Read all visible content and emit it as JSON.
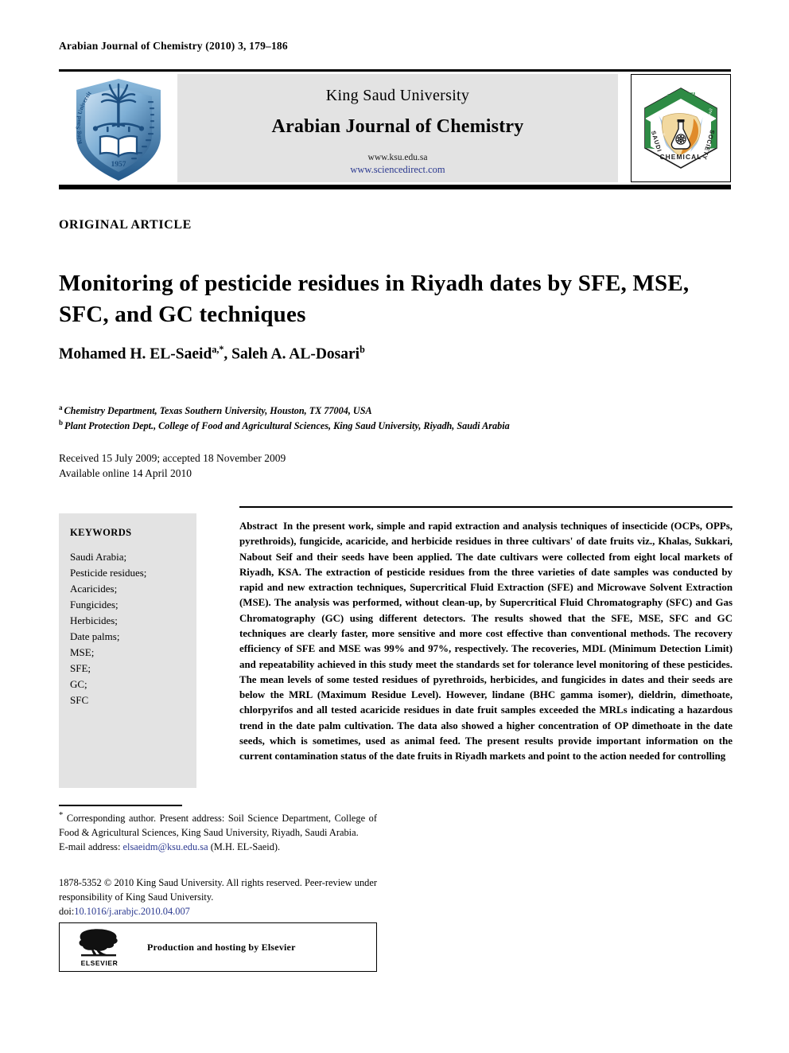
{
  "running_head": "Arabian Journal of Chemistry (2010) 3, 179–186",
  "masthead": {
    "organization": "King Saud University",
    "journal_name": "Arabian Journal of Chemistry",
    "url_org": "www.ksu.edu.sa",
    "url_publisher": "www.sciencedirect.com",
    "left_logo": "king-saud-university-shield-logo",
    "right_logo": "saudi-chemical-society-hexagon-logo",
    "left_logo_text": {
      "outer_left": "King Saud University",
      "year": "1957"
    },
    "right_logo_text": {
      "top_arabic": "الكيميائية",
      "left_arabic": "السعودية",
      "right_arabic": "الجمعية",
      "bottom": "CHEMICAL",
      "left": "SAUDI",
      "right": "SOCIETY"
    },
    "colors": {
      "band": "#e3e3e3",
      "link": "#2b3990",
      "shield_blue": "#2e6da8",
      "society_green": "#2e8b45",
      "society_orange": "#e08b2a",
      "society_map": "#f2d9a0"
    }
  },
  "article_type": "ORIGINAL ARTICLE",
  "title": "Monitoring of pesticide residues in Riyadh dates by SFE, MSE, SFC, and GC techniques",
  "authors": [
    {
      "name": "Mohamed H. EL-Saeid",
      "marks": "a,*"
    },
    {
      "name": "Saleh A. AL-Dosari",
      "marks": "b"
    }
  ],
  "affiliations": [
    {
      "mark": "a",
      "text": "Chemistry Department, Texas Southern University, Houston, TX 77004, USA"
    },
    {
      "mark": "b",
      "text": "Plant Protection Dept., College of Food and Agricultural Sciences, King Saud University, Riyadh, Saudi Arabia"
    }
  ],
  "history": {
    "received": "Received 15 July 2009; accepted 18 November 2009",
    "available": "Available online 14 April 2010"
  },
  "keywords": {
    "title": "KEYWORDS",
    "items": [
      "Saudi Arabia;",
      "Pesticide residues;",
      "Acaricides;",
      "Fungicides;",
      "Herbicides;",
      "Date palms;",
      "MSE;",
      "SFE;",
      "GC;",
      "SFC"
    ]
  },
  "abstract": {
    "label": "Abstract",
    "text": "In the present work, simple and rapid extraction and analysis techniques of insecticide (OCPs, OPPs, pyrethroids), fungicide, acaricide, and herbicide residues in three cultivars' of date fruits viz., Khalas, Sukkari, Nabout Seif and their seeds have been applied. The date cultivars were collected from eight local markets of Riyadh, KSA. The extraction of pesticide residues from the three varieties of date samples was conducted by rapid and new extraction techniques, Supercritical Fluid Extraction (SFE) and Microwave Solvent Extraction (MSE). The analysis was performed, without clean-up, by Supercritical Fluid Chromatography (SFC) and Gas Chromatography (GC) using different detectors. The results showed that the SFE, MSE, SFC and GC techniques are clearly faster, more sensitive and more cost effective than conventional methods. The recovery efficiency of SFE and MSE was 99% and 97%, respectively. The recoveries, MDL (Minimum Detection Limit) and repeatability achieved in this study meet the standards set for tolerance level monitoring of these pesticides. The mean levels of some tested residues of pyrethroids, herbicides, and fungicides in dates and their seeds are below the MRL (Maximum Residue Level). However, lindane (BHC gamma isomer), dieldrin, dimethoate, chlorpyrifos and all tested acaricide residues in date fruit samples exceeded the MRLs indicating a hazardous trend in the date palm cultivation. The data also showed a higher concentration of OP dimethoate in the date seeds, which is sometimes, used as animal feed. The present results provide important information on the current contamination status of the date fruits in Riyadh markets and point to the action needed for controlling"
  },
  "footnote": {
    "mark": "*",
    "text": "Corresponding author. Present address: Soil Science Department, College of Food & Agricultural Sciences, King Saud University, Riyadh, Saudi Arabia.",
    "email_label": "E-mail address:",
    "email": "elsaeidm@ksu.edu.sa",
    "email_suffix": "(M.H. EL-Saeid)."
  },
  "copyright": {
    "text": "1878-5352 © 2010 King Saud University. All rights reserved. Peer-review under responsibility of King Saud University.",
    "doi_label": "doi:",
    "doi": "10.1016/j.arabjc.2010.04.007"
  },
  "elsevier": {
    "caption": "Production and hosting by Elsevier",
    "wordmark": "ELSEVIER",
    "logo": "elsevier-tree-logo"
  }
}
